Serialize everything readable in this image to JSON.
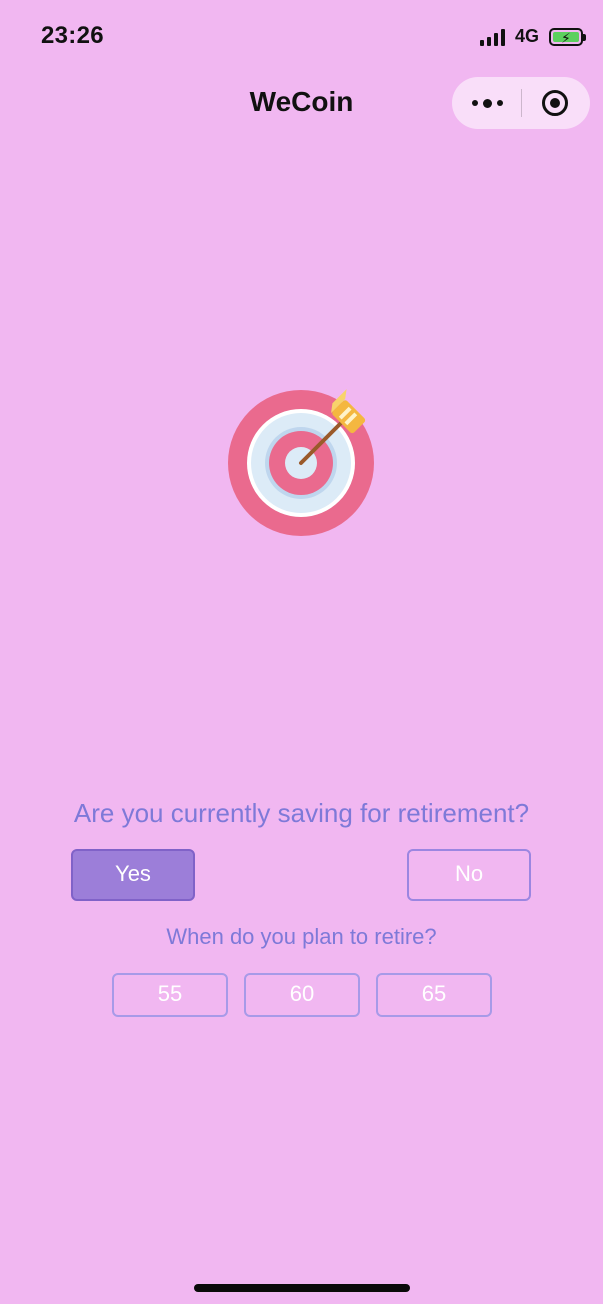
{
  "status_bar": {
    "time": "23:26",
    "network": "4G",
    "icons": [
      "signal-icon",
      "battery-charging-icon"
    ]
  },
  "nav": {
    "title": "WeCoin",
    "capsule_icons": [
      "more-icon",
      "close-miniprogram-icon"
    ]
  },
  "illustration": {
    "icon": "target-arrow-icon"
  },
  "retirement_question": {
    "text": "Are you currently saving for retirement?",
    "options": [
      "Yes",
      "No"
    ],
    "selected": "Yes"
  },
  "age_question": {
    "text": "When do you plan to retire?",
    "options": [
      "55",
      "60",
      "65"
    ]
  },
  "colors": {
    "background": "#F1B7F1",
    "accent_text": "#7E79D8",
    "selected_button": "#9C7ED9",
    "button_border": "#9B86E1"
  }
}
